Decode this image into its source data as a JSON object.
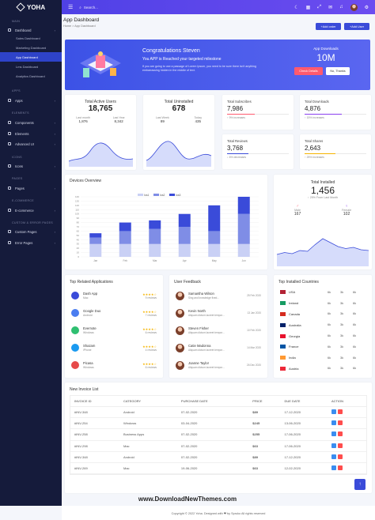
{
  "brand": {
    "name": "YOHA"
  },
  "sidebar": {
    "sections": [
      {
        "title": "Main",
        "top": 25
      },
      {
        "title": "Apps",
        "top": 113
      },
      {
        "title": "Elements",
        "top": 141
      },
      {
        "title": "Icons",
        "top": 197
      },
      {
        "title": "Pages",
        "top": 224
      },
      {
        "title": "E-Commerce",
        "top": 252
      },
      {
        "title": "Custom & Error Pages",
        "top": 280
      }
    ],
    "items": [
      {
        "label": "Dashboard",
        "top": 36
      },
      {
        "label": "Apps",
        "top": 125
      },
      {
        "label": "Components",
        "top": 153
      },
      {
        "label": "Elements",
        "top": 167
      },
      {
        "label": "Advanced UI",
        "top": 180
      },
      {
        "label": "Icons",
        "top": 208
      },
      {
        "label": "Pages",
        "top": 236
      },
      {
        "label": "E-commerce",
        "top": 264
      },
      {
        "label": "Custom Pages",
        "top": 291
      },
      {
        "label": "Error Pages",
        "top": 305
      }
    ],
    "subitems": [
      {
        "label": "Sales Dashboard",
        "top": 47
      },
      {
        "label": "Marketing Dashboard",
        "top": 59
      },
      {
        "label": "App Dashboard",
        "top": 71,
        "active": true
      },
      {
        "label": "Lms Dashboard",
        "top": 83
      },
      {
        "label": "Analytics Dashboard",
        "top": 95
      }
    ]
  },
  "topbar": {
    "search_placeholder": "Search..."
  },
  "page": {
    "title": "App Dashboard",
    "breadcrumb_home": "Home",
    "breadcrumb_current": "App Dashboard",
    "add_order": "Add order",
    "add_user": "Add User"
  },
  "banner": {
    "title": "Congratulations Steven",
    "subtitle": "You APP is Reached your targeted milestone",
    "text": "If you are going to use a passage of Lorem Ipsum, you need to be sure there isn't anything embarrassing hidden in the middle of text.",
    "downloads_label": "App Downloads",
    "downloads_value": "10M",
    "btn_check": "Check Details",
    "btn_thanks": "No, Thanks"
  },
  "kpis": {
    "active": {
      "title": "Total Active Users",
      "value": "18,765",
      "last_label": "Last month",
      "last_value": "1,876",
      "last_year_label": "Last Year",
      "last_year_value": "8,342"
    },
    "uninstalled": {
      "title": "Total Uninstalled",
      "value": "678",
      "last_label": "Last Week",
      "last_value": "89",
      "today_label": "Today",
      "today_value": "435"
    }
  },
  "mini": [
    {
      "title": "Total Subscribes",
      "value": "7,986",
      "trend": "↑ 9% increases",
      "color": "#ff5a6e",
      "fill": 0.45
    },
    {
      "title": "Total Downloads",
      "value": "4,876",
      "trend": "↑ 15% increases",
      "color": "#8a3ff0",
      "fill": 0.6
    },
    {
      "title": "Total Reviews",
      "value": "3,768",
      "trend": "↓ 6% decreases",
      "color": "#3a4bd9",
      "fill": 0.35
    },
    {
      "title": "Total Shares",
      "value": "2,643",
      "trend": "↑ 25% increases",
      "color": "#f5b400",
      "fill": 0.5
    }
  ],
  "devices": {
    "title": "Devices Overview",
    "legend": [
      "Ios1",
      "Ios2",
      "Ios3"
    ]
  },
  "installed": {
    "title": "Total Installed",
    "value": "1,456",
    "trend": "↑ 25% From Last Month",
    "male_label": "Male",
    "male_value": "167",
    "female_label": "Female",
    "female_value": "102"
  },
  "apps": {
    "title": "Top Related Applications",
    "rows": [
      {
        "name": "Dash App",
        "os": "Mac",
        "reviews": "9 reviews",
        "color": "#3a4bd9"
      },
      {
        "name": "Google Duo",
        "os": "Android",
        "reviews": "7 reviews",
        "color": "#4a7df0"
      },
      {
        "name": "Evernote",
        "os": "Windows",
        "reviews": "6 reviews",
        "color": "#2fbf71"
      },
      {
        "name": "Shazam",
        "os": "iPhone",
        "reviews": "4 reviews",
        "color": "#1a9af0"
      },
      {
        "name": "Picasa",
        "os": "Windows",
        "reviews": "6 reviews",
        "color": "#e64a4a"
      }
    ]
  },
  "feedback": {
    "title": "User Feedback",
    "rows": [
      {
        "name": "Samantha Wilson",
        "text": "Sing and knowledge fixed...",
        "date": "25 Feb 2020"
      },
      {
        "name": "Kevin North",
        "text": "Aliquam dictum laoreet tempor...",
        "date": "13 Jan 2020"
      },
      {
        "name": "Steven Fisher",
        "text": "Aliquam dictum laoreet tempor...",
        "date": "10 Feb 2020"
      },
      {
        "name": "Catie Madonna",
        "text": "Aliquam dictum laoreet tempor...",
        "date": "14 Mar 2020"
      },
      {
        "name": "Joanne Taylor",
        "text": "Aliquam dictum laoreet tempor...",
        "date": "26 Dec 2020"
      }
    ]
  },
  "countries": {
    "title": "Top Installed Countries",
    "rows": [
      {
        "name": "USA",
        "a": "6k",
        "b": "3k",
        "c": "6k",
        "flag": "#b22234"
      },
      {
        "name": "Ireland",
        "a": "6k",
        "b": "3k",
        "c": "6k",
        "flag": "#169b62"
      },
      {
        "name": "Canada",
        "a": "6k",
        "b": "3k",
        "c": "6k",
        "flag": "#d52b1e"
      },
      {
        "name": "Australia",
        "a": "6k",
        "b": "3k",
        "c": "6k",
        "flag": "#012169"
      },
      {
        "name": "Georgia",
        "a": "6k",
        "b": "3k",
        "c": "6k",
        "flag": "#e8112d"
      },
      {
        "name": "France",
        "a": "6k",
        "b": "3k",
        "c": "6k",
        "flag": "#0055a4"
      },
      {
        "name": "India",
        "a": "6k",
        "b": "3k",
        "c": "6k",
        "flag": "#ff9933"
      },
      {
        "name": "Austria",
        "a": "6k",
        "b": "3k",
        "c": "6k",
        "flag": "#ed2939"
      }
    ]
  },
  "invoice": {
    "title": "New Invoice List",
    "headers": [
      "INVOICE ID",
      "CATEGORY",
      "PURCHASE DATE",
      "PRICE",
      "DUE DATE",
      "ACTION"
    ],
    "rows": [
      [
        "#INV-348",
        "Android",
        "07-02-2020",
        "$89",
        "17-12-2020"
      ],
      [
        "#INV-254",
        "Windows",
        "03-04-2020",
        "$245",
        "13-06-2020"
      ],
      [
        "#INV-258",
        "Business Apps",
        "07-02-2020",
        "$255",
        "17-06-2020"
      ],
      [
        "#INV-298",
        "Mac",
        "07-02-2020",
        "$63",
        "17-06-2020"
      ],
      [
        "#INV-348",
        "Android",
        "07-02-2020",
        "$89",
        "17-12-2020"
      ],
      [
        "#INV-269",
        "Mac",
        "19-06-2020",
        "$63",
        "12-02-2020"
      ]
    ]
  },
  "footer": {
    "text": "Copyright © 2022 Yoha. Designed with ❤ by Spruko All rights reserved"
  },
  "watermark": "www.DownloadNewThemes.com",
  "chart_data": [
    {
      "type": "bar",
      "title": "Devices Overview",
      "categories": [
        "Jan",
        "Feb",
        "Mar",
        "Apr",
        "May",
        "Jun"
      ],
      "ylim": [
        0,
        140
      ],
      "yticks": [
        0,
        10,
        20,
        30,
        40,
        50,
        60,
        70,
        80,
        90,
        100,
        110,
        120,
        130,
        140
      ],
      "series": [
        {
          "name": "Ios1",
          "values": [
            30,
            30,
            30,
            30,
            30,
            30
          ]
        },
        {
          "name": "Ios2",
          "values": [
            15,
            30,
            35,
            40,
            30,
            70
          ]
        },
        {
          "name": "Ios3",
          "values": [
            10,
            20,
            20,
            30,
            60,
            40
          ]
        }
      ],
      "colors": [
        "#c9d0f5",
        "#7f8de6",
        "#3a4bd9"
      ]
    },
    {
      "type": "area",
      "title": "Total Installed",
      "values": [
        30,
        35,
        32,
        40,
        38,
        55,
        70,
        60,
        50,
        45,
        48,
        42,
        40
      ]
    }
  ]
}
